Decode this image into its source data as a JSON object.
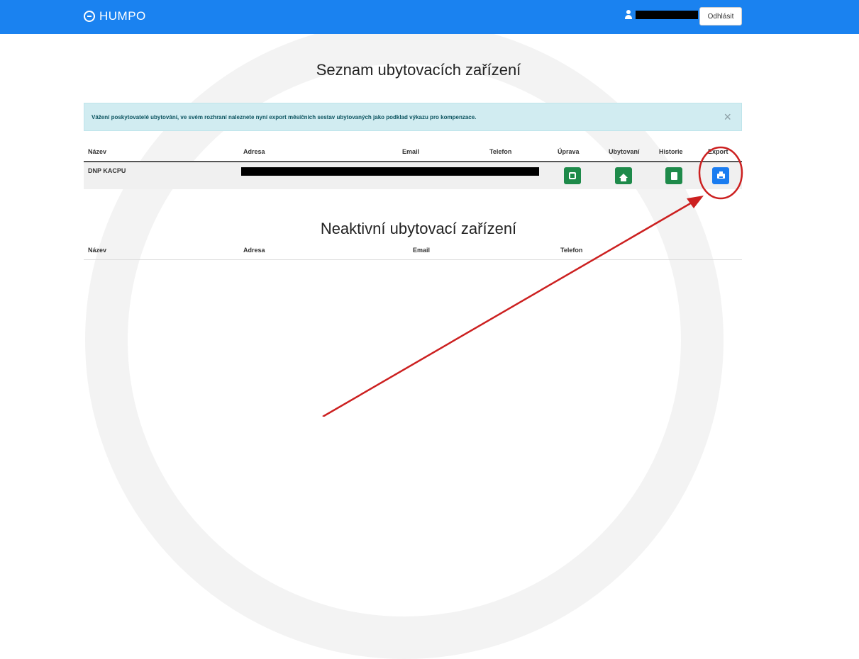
{
  "topbar": {
    "brand": "HUMPO",
    "logout_label": "Odhlásit"
  },
  "main": {
    "title": "Seznam ubytovacích zařízení",
    "alert_text": "Vážení poskytovatelé ubytování, ve svém rozhraní naleznete nyní export měsíčních sestav ubytovaných jako podklad výkazu pro kompenzace.",
    "alert_close": "×",
    "columns": {
      "name": "Název",
      "address": "Adresa",
      "email": "Email",
      "phone": "Telefon",
      "edit": "Úprava",
      "guests": "Ubytovaní",
      "history": "Historie",
      "export": "Export"
    },
    "rows": [
      {
        "name": "DNP KACPU"
      }
    ]
  },
  "inactive": {
    "title": "Neaktivní ubytovací zařízení",
    "columns": {
      "name": "Název",
      "address": "Adresa",
      "email": "Email",
      "phone": "Telefon"
    }
  },
  "colors": {
    "topbar": "#1a82f0",
    "alert_bg": "#d1ecf1",
    "action_green": "#1e8a4a",
    "action_blue": "#1a7cf0",
    "annotation_red": "#cc2020"
  },
  "icons": {
    "brand": "humpo-logo-icon",
    "user": "user-icon",
    "edit": "edit-icon",
    "guests": "home-icon",
    "history": "book-icon",
    "export": "print-icon"
  }
}
